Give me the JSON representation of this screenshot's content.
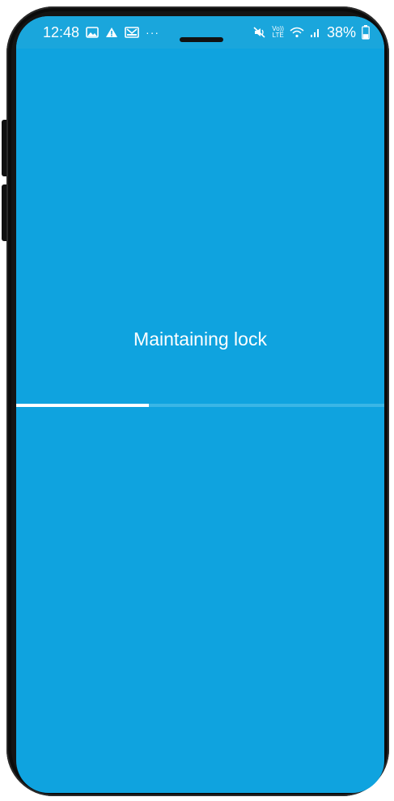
{
  "status_bar": {
    "time": "12:48",
    "left_icons": [
      "gallery-icon",
      "alert-icon",
      "mail-icon",
      "more-dots-icon"
    ],
    "more": "···",
    "right_icons": [
      "mute-icon",
      "volte-icon",
      "wifi-icon",
      "signal-icon",
      "battery-icon"
    ],
    "volte_line1": "Vo))",
    "volte_line2": "LTE",
    "battery_percent": "38%",
    "battery_level": 0.38
  },
  "main": {
    "message": "Maintaining lock",
    "progress": 0.36
  },
  "colors": {
    "screen_bg": "#0fa3df",
    "status_bg": "#1aa6dc",
    "progress_track": "#3ab6e6",
    "progress_fill": "#ffffff",
    "text": "#ffffff"
  }
}
